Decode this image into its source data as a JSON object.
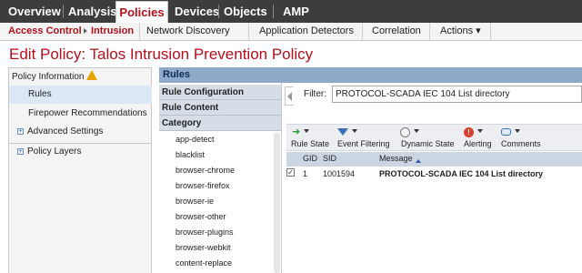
{
  "topnav": {
    "tabs": [
      {
        "label": "Overview"
      },
      {
        "label": "Analysis"
      },
      {
        "label": "Policies"
      },
      {
        "label": "Devices"
      },
      {
        "label": "Objects"
      },
      {
        "label": "AMP"
      }
    ],
    "active": "Policies"
  },
  "subnav": {
    "breadcrumb": [
      "Access Control",
      "Intrusion"
    ],
    "items": [
      {
        "label": "Network Discovery"
      },
      {
        "label": "Application Detectors"
      },
      {
        "label": "Correlation"
      },
      {
        "label": "Actions ▾"
      }
    ]
  },
  "page": {
    "title": "Edit Policy: Talos Intrusion Prevention Policy"
  },
  "sidebar": {
    "items": [
      {
        "label": "Policy Information",
        "icon": "warning-icon"
      },
      {
        "label": "Rules",
        "selected": true
      },
      {
        "label": "Firepower Recommendations"
      },
      {
        "label": "Advanced Settings",
        "icon": "expand-icon"
      },
      {
        "label": "Policy Layers",
        "icon": "expand-icon"
      }
    ]
  },
  "rules": {
    "header": "Rules",
    "sections": [
      "Rule Configuration",
      "Rule Content",
      "Category"
    ],
    "categories": [
      "app-detect",
      "blacklist",
      "browser-chrome",
      "browser-firefox",
      "browser-ie",
      "browser-other",
      "browser-plugins",
      "browser-webkit",
      "content-replace"
    ],
    "filter": {
      "label": "Filter:",
      "value": "PROTOCOL-SCADA IEC 104 List directory"
    },
    "toolbar": [
      {
        "label": "Rule State",
        "icon": "arrow-right-icon"
      },
      {
        "label": "Event Filtering",
        "icon": "funnel-icon"
      },
      {
        "label": "Dynamic State",
        "icon": "clock-icon"
      },
      {
        "label": "Alerting",
        "icon": "alert-icon"
      },
      {
        "label": "Comments",
        "icon": "comment-icon"
      }
    ],
    "table": {
      "columns": [
        "GID",
        "SID",
        "Message"
      ],
      "sort_column": "Message",
      "rows": [
        {
          "checked": true,
          "gid": "1",
          "sid": "1001594",
          "message": "PROTOCOL-SCADA IEC 104 List directory"
        }
      ]
    }
  },
  "colors": {
    "brand_red": "#b30f1c",
    "nav_dark": "#3d3d3d",
    "rules_header": "#8fa9c9"
  }
}
